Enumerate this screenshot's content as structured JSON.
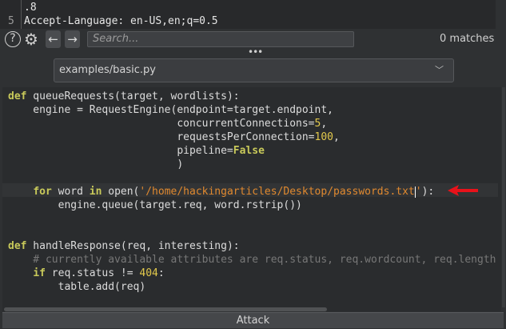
{
  "request_view": {
    "lines": [
      {
        "num": "",
        "text": ".8"
      },
      {
        "num": "5",
        "text": "Accept-Language: en-US,en;q=0.5"
      }
    ]
  },
  "search": {
    "placeholder": "Search...",
    "matches": "0 matches"
  },
  "script_select": {
    "value": "examples/basic.py"
  },
  "code": {
    "lines": [
      [
        [
          "def",
          "kw"
        ],
        [
          " queueRequests(target, wordlists):",
          ""
        ]
      ],
      [
        [
          "    engine = RequestEngine(endpoint=target.endpoint,",
          ""
        ]
      ],
      [
        [
          "                           concurrentConnections=",
          ""
        ],
        [
          "5",
          "num"
        ],
        [
          ",",
          ""
        ]
      ],
      [
        [
          "                           requestsPerConnection=",
          ""
        ],
        [
          "100",
          "num"
        ],
        [
          ",",
          ""
        ]
      ],
      [
        [
          "                           pipeline=",
          ""
        ],
        [
          "False",
          "kw"
        ]
      ],
      [
        [
          "                           )",
          ""
        ]
      ],
      [],
      [
        [
          "    ",
          ""
        ],
        [
          "for",
          "kw"
        ],
        [
          " word ",
          ""
        ],
        [
          "in",
          "kw"
        ],
        [
          " open(",
          ""
        ],
        [
          "'/home/hackingarticles/Desktop/passwords.txt",
          "str"
        ],
        [
          "|",
          "cursor"
        ],
        [
          "'",
          "str"
        ],
        [
          "):",
          ""
        ]
      ],
      [
        [
          "        engine.queue(target.req, word.rstrip())",
          ""
        ]
      ],
      [],
      [],
      [
        [
          "def",
          "kw"
        ],
        [
          " handleResponse(req, interesting):",
          ""
        ]
      ],
      [
        [
          "    # currently available attributes are req.status, req.wordcount, req.length and req.response",
          "cm"
        ]
      ],
      [
        [
          "    ",
          ""
        ],
        [
          "if",
          "kw"
        ],
        [
          " req.status != ",
          ""
        ],
        [
          "404",
          "num"
        ],
        [
          ":",
          ""
        ]
      ],
      [
        [
          "        table.add(req)",
          ""
        ]
      ]
    ]
  },
  "attack_button": "Attack",
  "colors": {
    "annotation_arrow": "#e8121a"
  }
}
